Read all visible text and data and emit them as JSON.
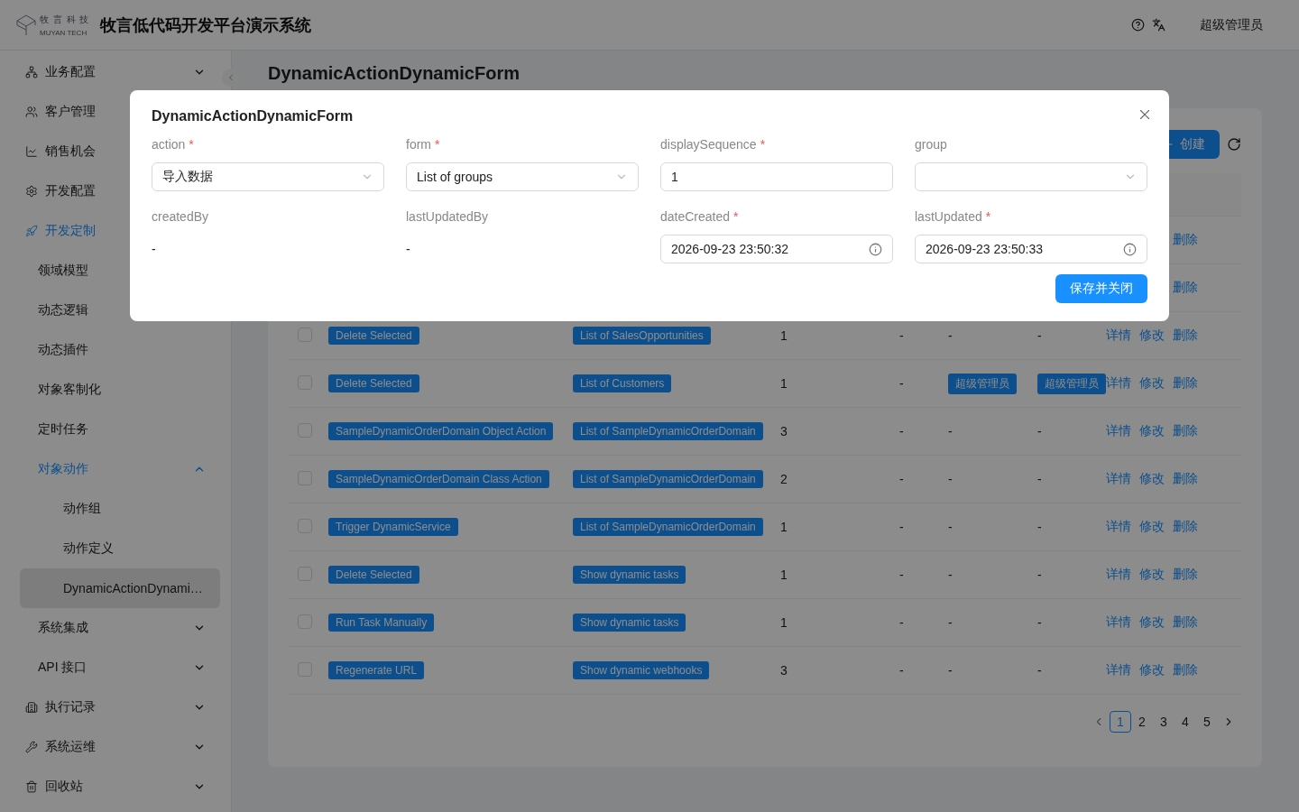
{
  "header": {
    "logo_top": "牧 言 科 技",
    "logo_bottom": "MUYAN TECH",
    "title": "牧言低代码开发平台演示系统",
    "user": "超级管理员"
  },
  "sidebar": {
    "items": [
      {
        "label": "业务配置",
        "expanded": false,
        "selected": false
      },
      {
        "label": "客户管理",
        "selected": false
      },
      {
        "label": "销售机会",
        "selected": false
      },
      {
        "label": "开发配置",
        "selected": false
      },
      {
        "label": "开发定制",
        "expanded": true,
        "selected": true,
        "children": [
          {
            "label": "领域模型",
            "selected": false
          },
          {
            "label": "动态逻辑",
            "selected": false
          },
          {
            "label": "动态插件",
            "selected": false
          },
          {
            "label": "对象客制化",
            "selected": false
          },
          {
            "label": "定时任务",
            "selected": false
          },
          {
            "label": "对象动作",
            "expanded": true,
            "selected": true,
            "children": [
              {
                "label": "动作组",
                "selected": false
              },
              {
                "label": "动作定义",
                "selected": false
              },
              {
                "label": "DynamicActionDynami…",
                "selected": true
              }
            ]
          },
          {
            "label": "系统集成",
            "expanded": false,
            "selected": false
          },
          {
            "label": "API 接口",
            "expanded": false,
            "selected": false
          }
        ]
      },
      {
        "label": "执行记录",
        "expanded": false,
        "selected": false
      },
      {
        "label": "系统运维",
        "expanded": false,
        "selected": false
      },
      {
        "label": "回收站",
        "expanded": false,
        "selected": false
      }
    ]
  },
  "page": {
    "title": "DynamicActionDynamicForm",
    "create_button": "创建",
    "rows": [
      {
        "actions": [
          "删除"
        ]
      },
      {
        "actions": [
          "删除"
        ]
      },
      {
        "checked": false,
        "action": "Delete Selected",
        "form": "List of SalesOpportunities",
        "sequence": "1",
        "column_5": {
          "kind": "text",
          "text": "-"
        },
        "column_6": {
          "kind": "text",
          "text": "-"
        },
        "column_7": {
          "kind": "text",
          "text": "-"
        },
        "actions": [
          "详情",
          "修改",
          "删除"
        ]
      },
      {
        "checked": false,
        "action": "Delete Selected",
        "form": "List of Customers",
        "sequence": "1",
        "column_5": {
          "kind": "text",
          "text": "-"
        },
        "column_6": {
          "kind": "tag",
          "text": "超级管理员"
        },
        "column_7": {
          "kind": "tag",
          "text": "超级管理员"
        },
        "actions": [
          "详情",
          "修改",
          "删除"
        ]
      },
      {
        "checked": false,
        "action": "SampleDynamicOrderDomain Object Action",
        "form": "List of SampleDynamicOrderDomain",
        "sequence": "3",
        "column_5": {
          "kind": "text",
          "text": "-"
        },
        "column_6": {
          "kind": "text",
          "text": "-"
        },
        "column_7": {
          "kind": "text",
          "text": "-"
        },
        "actions": [
          "详情",
          "修改",
          "删除"
        ]
      },
      {
        "checked": false,
        "action": "SampleDynamicOrderDomain Class Action",
        "form": "List of SampleDynamicOrderDomain",
        "sequence": "2",
        "column_5": {
          "kind": "text",
          "text": "-"
        },
        "column_6": {
          "kind": "text",
          "text": "-"
        },
        "column_7": {
          "kind": "text",
          "text": "-"
        },
        "actions": [
          "详情",
          "修改",
          "删除"
        ]
      },
      {
        "checked": false,
        "action": "Trigger DynamicService",
        "form": "List of SampleDynamicOrderDomain",
        "sequence": "1",
        "column_5": {
          "kind": "text",
          "text": "-"
        },
        "column_6": {
          "kind": "text",
          "text": "-"
        },
        "column_7": {
          "kind": "text",
          "text": "-"
        },
        "actions": [
          "详情",
          "修改",
          "删除"
        ]
      },
      {
        "checked": false,
        "action": "Delete Selected",
        "form": "Show dynamic tasks",
        "sequence": "1",
        "column_5": {
          "kind": "text",
          "text": "-"
        },
        "column_6": {
          "kind": "text",
          "text": "-"
        },
        "column_7": {
          "kind": "text",
          "text": "-"
        },
        "actions": [
          "详情",
          "修改",
          "删除"
        ]
      },
      {
        "checked": false,
        "action": "Run Task Manually",
        "form": "Show dynamic tasks",
        "sequence": "1",
        "column_5": {
          "kind": "text",
          "text": "-"
        },
        "column_6": {
          "kind": "text",
          "text": "-"
        },
        "column_7": {
          "kind": "text",
          "text": "-"
        },
        "actions": [
          "详情",
          "修改",
          "删除"
        ]
      },
      {
        "checked": false,
        "action": "Regenerate URL",
        "form": "Show dynamic webhooks",
        "sequence": "3",
        "column_5": {
          "kind": "text",
          "text": "-"
        },
        "column_6": {
          "kind": "text",
          "text": "-"
        },
        "column_7": {
          "kind": "text",
          "text": "-"
        },
        "actions": [
          "详情",
          "修改",
          "删除"
        ]
      }
    ],
    "pagination": [
      {
        "label": "1",
        "selected": true
      },
      {
        "label": "2",
        "selected": false
      },
      {
        "label": "3",
        "selected": false
      },
      {
        "label": "4",
        "selected": false
      },
      {
        "label": "5",
        "selected": false
      }
    ]
  },
  "modal": {
    "title": "DynamicActionDynamicForm",
    "fields": [
      {
        "label": "action",
        "required_mark": "*",
        "kind": "select",
        "value": "导入数据"
      },
      {
        "label": "form",
        "required_mark": "*",
        "kind": "select",
        "value": "List of groups"
      },
      {
        "label": "displaySequence",
        "required_mark": "*",
        "kind": "input",
        "value": "1"
      },
      {
        "label": "group",
        "kind": "select"
      },
      {
        "label": "createdBy",
        "kind": "readonly",
        "value": "-"
      },
      {
        "label": "lastUpdatedBy",
        "kind": "readonly",
        "value": "-"
      },
      {
        "label": "dateCreated",
        "required_mark": "*",
        "kind": "date",
        "value": "2026-09-23 23:50:32"
      },
      {
        "label": "lastUpdated",
        "required_mark": "*",
        "kind": "date",
        "value": "2026-09-23 23:50:33"
      }
    ],
    "submit": "保存并关闭"
  }
}
